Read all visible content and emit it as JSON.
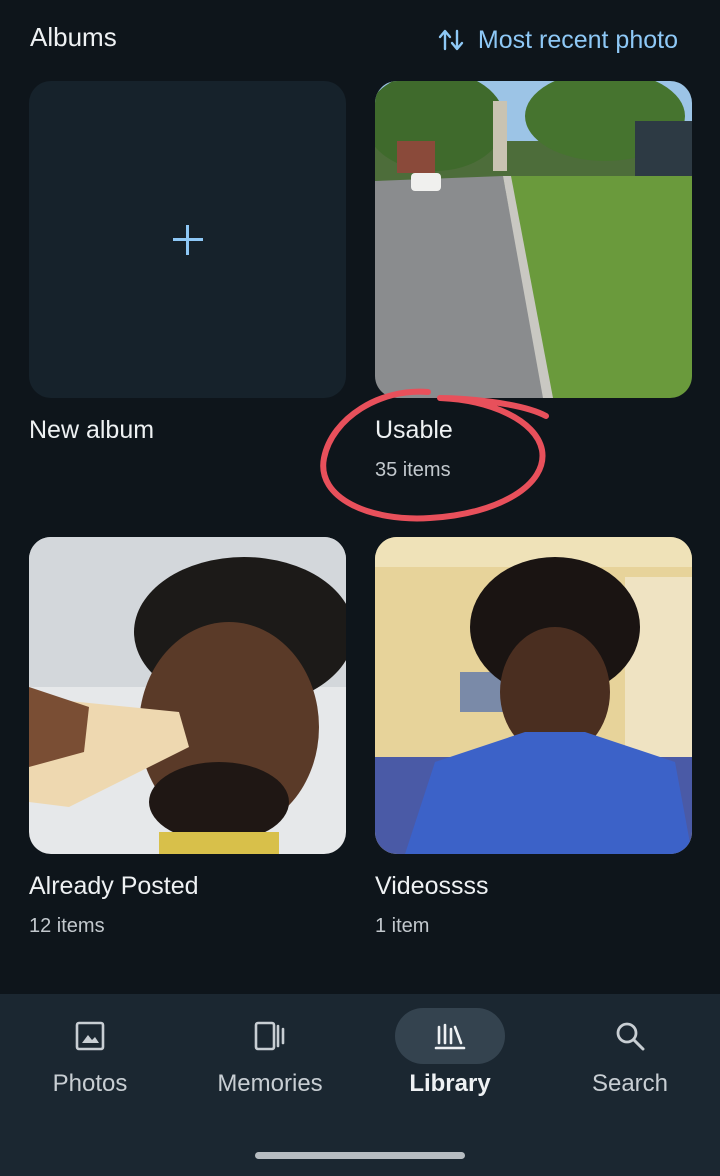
{
  "header": {
    "title": "Albums",
    "sort_label": "Most recent photo"
  },
  "albums": [
    {
      "name": "New album",
      "count": ""
    },
    {
      "name": "Usable",
      "count": "35 items"
    },
    {
      "name": "Already Posted",
      "count": "12 items"
    },
    {
      "name": "Videossss",
      "count": "1 item"
    }
  ],
  "nav": {
    "items": [
      {
        "label": "Photos",
        "icon": "photo-icon"
      },
      {
        "label": "Memories",
        "icon": "memories-icon"
      },
      {
        "label": "Library",
        "icon": "library-icon",
        "active": true
      },
      {
        "label": "Search",
        "icon": "search-icon"
      }
    ]
  },
  "colors": {
    "background": "#0e151b",
    "accent": "#8ec8f6",
    "annotation": "#e8505b",
    "nav_background": "#1b2731"
  }
}
